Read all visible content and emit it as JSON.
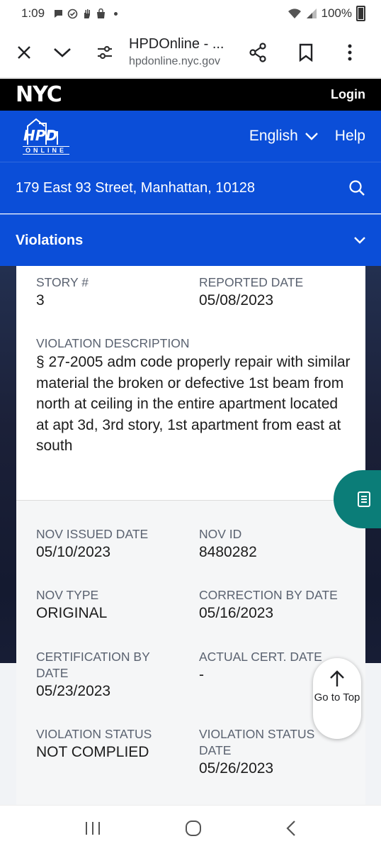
{
  "status_bar": {
    "time": "1:09",
    "battery": "100%"
  },
  "browser": {
    "page_title": "HPDOnline - ...",
    "url": "hpdonline.nyc.gov"
  },
  "nyc_bar": {
    "logo": "NYC",
    "login": "Login"
  },
  "header": {
    "logo_text": "HPD",
    "logo_subtext": "ONLINE",
    "language": "English",
    "help": "Help"
  },
  "address": "179 East 93 Street, Manhattan, 10128",
  "section": {
    "title": "Violations"
  },
  "violation": {
    "story_label": "STORY #",
    "story_value": "3",
    "reported_label": "REPORTED DATE",
    "reported_value": "05/08/2023",
    "description_label": "VIOLATION DESCRIPTION",
    "description_value": "§ 27-2005 adm code properly repair with similar material the broken or defective 1st beam from north at ceiling in the entire apartment located at apt 3d, 3rd story, 1st apartment from east at south",
    "nov_issued_label": "NOV ISSUED DATE",
    "nov_issued_value": "05/10/2023",
    "nov_id_label": "NOV ID",
    "nov_id_value": "8480282",
    "nov_type_label": "NOV TYPE",
    "nov_type_value": "ORIGINAL",
    "correction_label": "CORRECTION BY DATE",
    "correction_value": "05/16/2023",
    "certification_label": "CERTIFICATION BY DATE",
    "certification_value": "05/23/2023",
    "actual_cert_label": "ACTUAL CERT. DATE",
    "actual_cert_value": "-",
    "status_label": "VIOLATION STATUS",
    "status_value": "NOT COMPLIED",
    "status_date_label": "VIOLATION STATUS DATE",
    "status_date_value": "05/26/2023"
  },
  "go_to_top": "Go to Top",
  "colors": {
    "brand_blue": "#0b4ed8",
    "teal": "#0b7d78"
  }
}
